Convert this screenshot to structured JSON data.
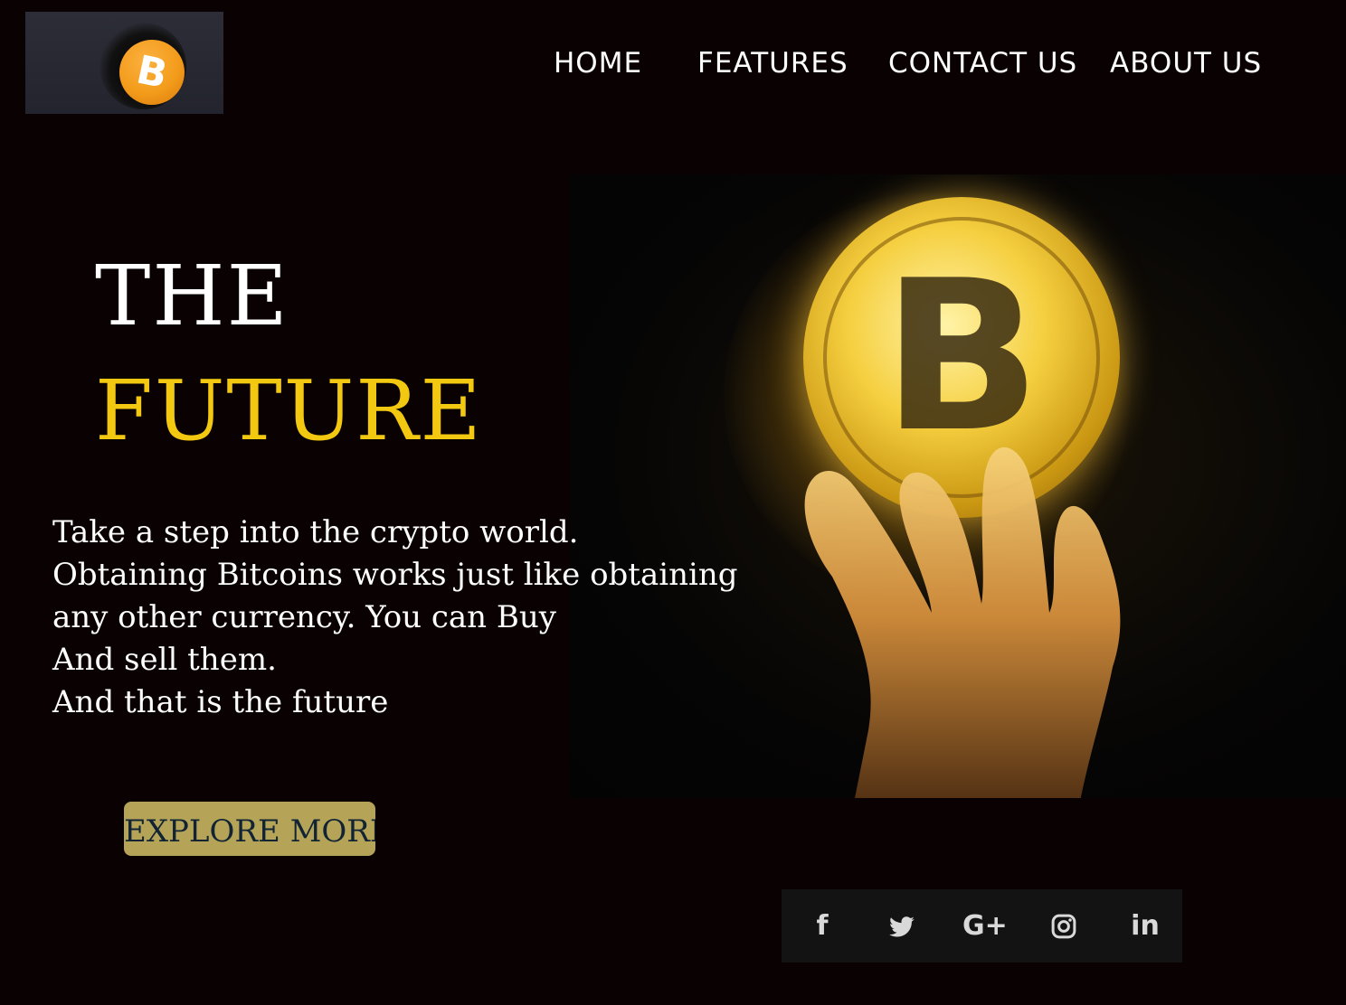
{
  "brand": {
    "logo_symbol": "B",
    "accent_color": "#f39c1b"
  },
  "nav": {
    "items": [
      {
        "label": "HOME"
      },
      {
        "label": "FEATURES"
      },
      {
        "label": "CONTACT US"
      },
      {
        "label": "ABOUT US"
      }
    ]
  },
  "hero": {
    "title_line1": "THE",
    "title_line2": "FUTURE",
    "title_accent_color": "#f2c811",
    "description_lines": [
      "Take a step into the crypto world.",
      "Obtaining Bitcoins works just like obtaining",
      "any other currency. You can Buy",
      "And sell them.",
      "And that is the future"
    ],
    "cta_label": "EXPLORE MORE",
    "cta_color": "#b5a458",
    "image_coin_symbol": "B"
  },
  "social": {
    "icons": [
      {
        "name": "facebook-icon",
        "glyph": "f"
      },
      {
        "name": "twitter-icon",
        "glyph": ""
      },
      {
        "name": "google-plus-icon",
        "glyph": "G+"
      },
      {
        "name": "instagram-icon",
        "glyph": ""
      },
      {
        "name": "linkedin-icon",
        "glyph": "in"
      }
    ]
  }
}
